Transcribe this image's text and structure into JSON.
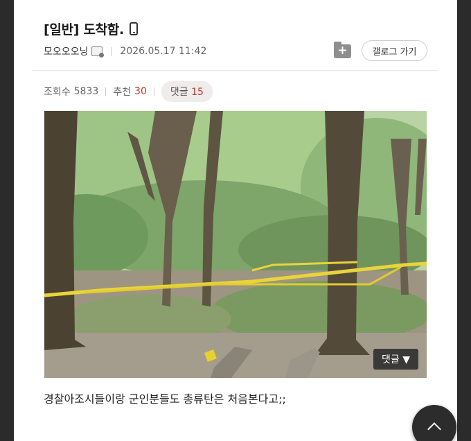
{
  "post": {
    "title": "[일반] 도착함.",
    "author": "모오오오닝",
    "date": "2026.05.17 11:42"
  },
  "actions": {
    "gallery_button": "갤로그 가기"
  },
  "stats": {
    "views_label": "조회수",
    "views": "5833",
    "recommend_label": "추천",
    "recommend": "30",
    "comments_label": "댓글",
    "comments": "15"
  },
  "photo": {
    "comment_button": "댓글 ▼"
  },
  "caption": "경찰아조시들이랑 군인분들도 총류탄은 처음본다고;;",
  "icons": {
    "device": "phone-icon",
    "badge": "author-badge-icon",
    "save": "folder-plus-icon",
    "top": "chevron-up-icon"
  }
}
